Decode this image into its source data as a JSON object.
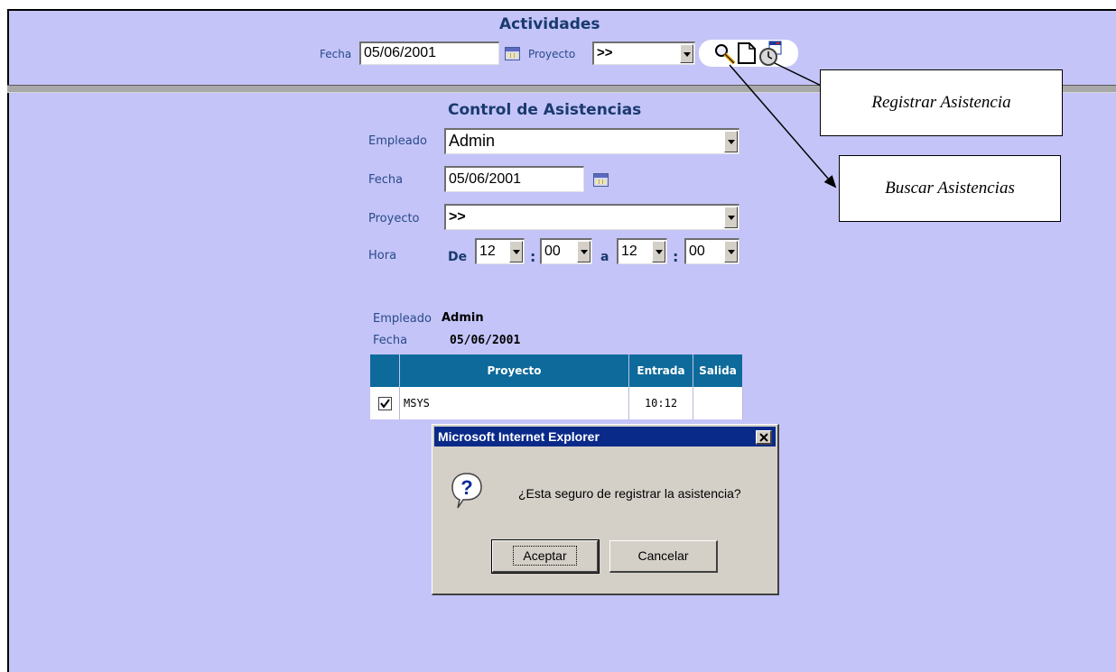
{
  "header": {
    "title": "Actividades",
    "fecha_label": "Fecha",
    "fecha_value": "05/06/2001",
    "proyecto_label": "Proyecto",
    "proyecto_value": ">>",
    "toolbar_icons": [
      "magnifier-icon",
      "new-document-icon",
      "clock-calendar-icon"
    ]
  },
  "form": {
    "title": "Control de Asistencias",
    "empleado_label": "Empleado",
    "empleado_value": "Admin",
    "fecha_label": "Fecha",
    "fecha_value": "05/06/2001",
    "proyecto_label": "Proyecto",
    "proyecto_value": ">>",
    "hora_label": "Hora",
    "de_label": "De",
    "a_label": "a",
    "colon": ":",
    "hora_de_h": "12",
    "hora_de_m": "00",
    "hora_a_h": "12",
    "hora_a_m": "00"
  },
  "summary": {
    "empleado_label": "Empleado",
    "empleado_value": "Admin",
    "fecha_label": "Fecha",
    "fecha_value": "05/06/2001"
  },
  "table": {
    "columns": [
      "Proyecto",
      "Entrada",
      "Salida"
    ],
    "rows": [
      {
        "checked": true,
        "proyecto": "MSYS",
        "entrada": "10:12",
        "salida": ""
      }
    ]
  },
  "dialog": {
    "title": "Microsoft Internet Explorer",
    "message": "¿Esta seguro de registrar la asistencia?",
    "ok_label": "Aceptar",
    "cancel_label": "Cancelar",
    "icon": "question-icon"
  },
  "callouts": {
    "registrar": "Registrar Asistencia",
    "buscar": "Buscar Asistencias"
  },
  "colors": {
    "background": "#c4c4f8",
    "table_header": "#0d6a9a",
    "dialog_titlebar": "#0a2a8a",
    "label_text": "#2a4a8a"
  }
}
